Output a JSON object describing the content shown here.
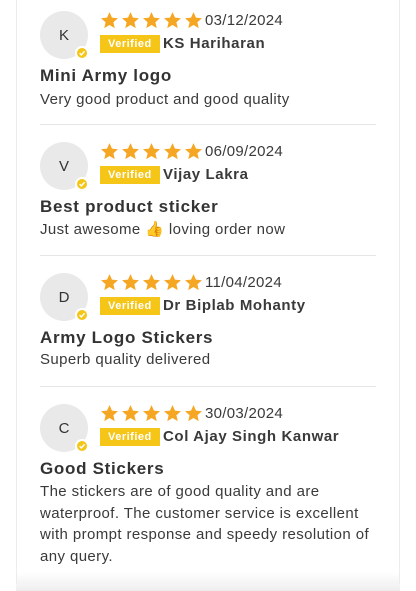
{
  "colors": {
    "star": "#f5a623",
    "badge": "#f5c518"
  },
  "reviews": [
    {
      "initial": "K",
      "rating": 5,
      "date": "03/12/2024",
      "badge": "Verified",
      "name": "KS Hariharan",
      "title": "Mini Army logo",
      "body": "Very good product and good quality"
    },
    {
      "initial": "V",
      "rating": 5,
      "date": "06/09/2024",
      "badge": "Verified",
      "name": "Vijay Lakra",
      "title": "Best product sticker",
      "body": "Just awesome 👍 loving order now"
    },
    {
      "initial": "D",
      "rating": 5,
      "date": "11/04/2024",
      "badge": "Verified",
      "name": "Dr Biplab Mohanty",
      "title": "Army Logo Stickers",
      "body": "Superb quality delivered"
    },
    {
      "initial": "C",
      "rating": 5,
      "date": "30/03/2024",
      "badge": "Verified",
      "name": "Col Ajay Singh Kanwar",
      "title": "Good Stickers",
      "body": "The stickers are of good quality and are waterproof. The customer service is excellent with prompt response and speedy resolution of any query."
    }
  ]
}
